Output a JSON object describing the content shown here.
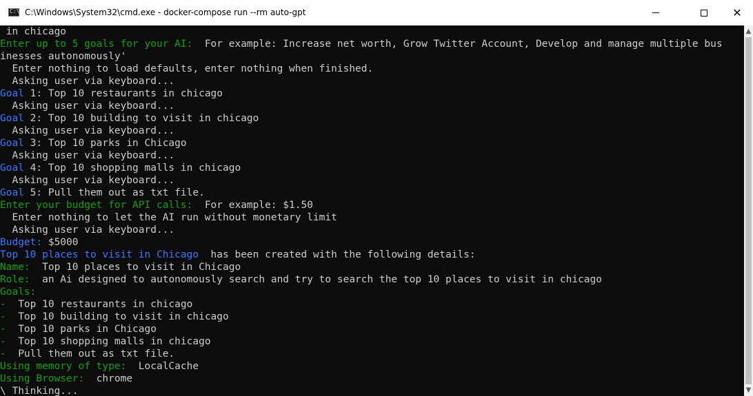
{
  "window": {
    "title": "C:\\Windows\\System32\\cmd.exe - docker-compose  run --rm auto-gpt",
    "minimize": "",
    "maximize": "",
    "close": "✕"
  },
  "colors": {
    "background": "#0c0c0c",
    "text": "#cccccc",
    "green": "#13a10e",
    "blue": "#3b78ff"
  },
  "console": {
    "lines": [
      [
        {
          "t": " in chicago",
          "c": ""
        }
      ],
      [
        {
          "t": "Enter up to 5 goals for your AI:",
          "c": "g"
        },
        {
          "t": "  For example: Increase net worth, Grow Twitter Account, Develop and manage multiple bus",
          "c": ""
        }
      ],
      [
        {
          "t": "inesses autonomously'",
          "c": ""
        }
      ],
      [
        {
          "t": "  Enter nothing to load defaults, enter nothing when finished.",
          "c": ""
        }
      ],
      [
        {
          "t": "  Asking user via keyboard...",
          "c": ""
        }
      ],
      [
        {
          "t": "Goal",
          "c": "b"
        },
        {
          "t": " 1: Top 10 restaurants in chicago",
          "c": ""
        }
      ],
      [
        {
          "t": "  Asking user via keyboard...",
          "c": ""
        }
      ],
      [
        {
          "t": "Goal",
          "c": "b"
        },
        {
          "t": " 2: Top 10 building to visit in chicago",
          "c": ""
        }
      ],
      [
        {
          "t": "  Asking user via keyboard...",
          "c": ""
        }
      ],
      [
        {
          "t": "Goal",
          "c": "b"
        },
        {
          "t": " 3: Top 10 parks in Chicago",
          "c": ""
        }
      ],
      [
        {
          "t": "  Asking user via keyboard...",
          "c": ""
        }
      ],
      [
        {
          "t": "Goal",
          "c": "b"
        },
        {
          "t": " 4: Top 10 shopping malls in chicago",
          "c": ""
        }
      ],
      [
        {
          "t": "  Asking user via keyboard...",
          "c": ""
        }
      ],
      [
        {
          "t": "Goal",
          "c": "b"
        },
        {
          "t": " 5: Pull them out as txt file.",
          "c": ""
        }
      ],
      [
        {
          "t": "Enter your budget for API calls:",
          "c": "g"
        },
        {
          "t": "  For example: $1.50",
          "c": ""
        }
      ],
      [
        {
          "t": "  Enter nothing to let the AI run without monetary limit",
          "c": ""
        }
      ],
      [
        {
          "t": "  Asking user via keyboard...",
          "c": ""
        }
      ],
      [
        {
          "t": "Budget:",
          "c": "b"
        },
        {
          "t": " $5000",
          "c": ""
        }
      ],
      [
        {
          "t": "Top 10 places to visit in Chicago",
          "c": "b"
        },
        {
          "t": "  has been created with the following details:",
          "c": ""
        }
      ],
      [
        {
          "t": "Name:",
          "c": "g"
        },
        {
          "t": "  Top 10 places to visit in Chicago",
          "c": ""
        }
      ],
      [
        {
          "t": "Role:",
          "c": "g"
        },
        {
          "t": "  an Ai designed to autonomously search and try to search the top 10 places to visit in chicago",
          "c": ""
        }
      ],
      [
        {
          "t": "Goals:",
          "c": "g"
        }
      ],
      [
        {
          "t": "-",
          "c": "g"
        },
        {
          "t": "  Top 10 restaurants in chicago",
          "c": ""
        }
      ],
      [
        {
          "t": "-",
          "c": "g"
        },
        {
          "t": "  Top 10 building to visit in chicago",
          "c": ""
        }
      ],
      [
        {
          "t": "-",
          "c": "g"
        },
        {
          "t": "  Top 10 parks in Chicago",
          "c": ""
        }
      ],
      [
        {
          "t": "-",
          "c": "g"
        },
        {
          "t": "  Top 10 shopping malls in chicago",
          "c": ""
        }
      ],
      [
        {
          "t": "-",
          "c": "g"
        },
        {
          "t": "  Pull them out as txt file.",
          "c": ""
        }
      ],
      [
        {
          "t": "Using memory of type:",
          "c": "g"
        },
        {
          "t": "  LocalCache",
          "c": ""
        }
      ],
      [
        {
          "t": "Using Browser:",
          "c": "g"
        },
        {
          "t": "  chrome",
          "c": ""
        }
      ],
      [
        {
          "t": "\\ Thinking...",
          "c": ""
        }
      ]
    ]
  }
}
